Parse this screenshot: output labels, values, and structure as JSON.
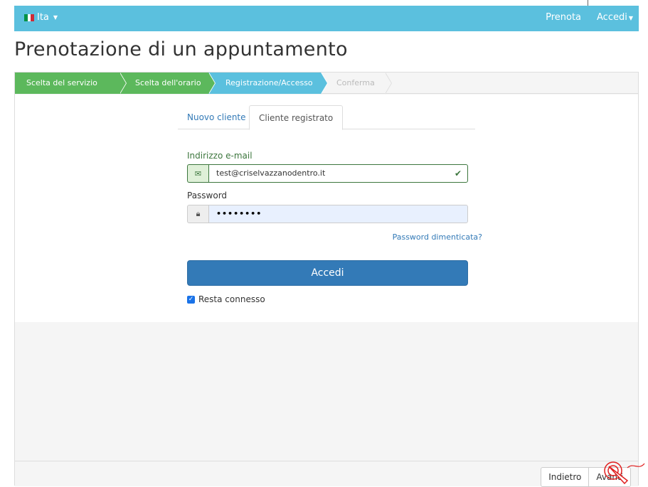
{
  "navbar": {
    "language_label": "Ita",
    "flag_colors": [
      "#009246",
      "#ffffff",
      "#ce2b37"
    ],
    "book_link": "Prenota",
    "login_menu": "Accedi"
  },
  "page_title": "Prenotazione di un appuntamento",
  "steps": [
    {
      "label": "Scelta del servizio",
      "state": "done"
    },
    {
      "label": "Scelta dell'orario",
      "state": "done"
    },
    {
      "label": "Registrazione/Accesso",
      "state": "active"
    },
    {
      "label": "Conferma",
      "state": "todo"
    }
  ],
  "tabs": {
    "new_client": "Nuovo cliente",
    "registered_client": "Cliente registrato",
    "active": "registered_client"
  },
  "form": {
    "email_label": "Indirizzo e-mail",
    "email_value": "test@criselvazzanodentro.it",
    "password_label": "Password",
    "password_value": "••••••••",
    "forgot_link": "Password dimenticata?",
    "login_button": "Accedi",
    "remember_label": "Resta connesso",
    "remember_checked": true
  },
  "footer": {
    "back_button": "Indietro",
    "next_button": "Avanti"
  },
  "colors": {
    "navbar": "#5bc0de",
    "step_done": "#5cb85c",
    "step_active": "#5bc0de",
    "primary": "#337ab7",
    "success": "#3c763d"
  }
}
